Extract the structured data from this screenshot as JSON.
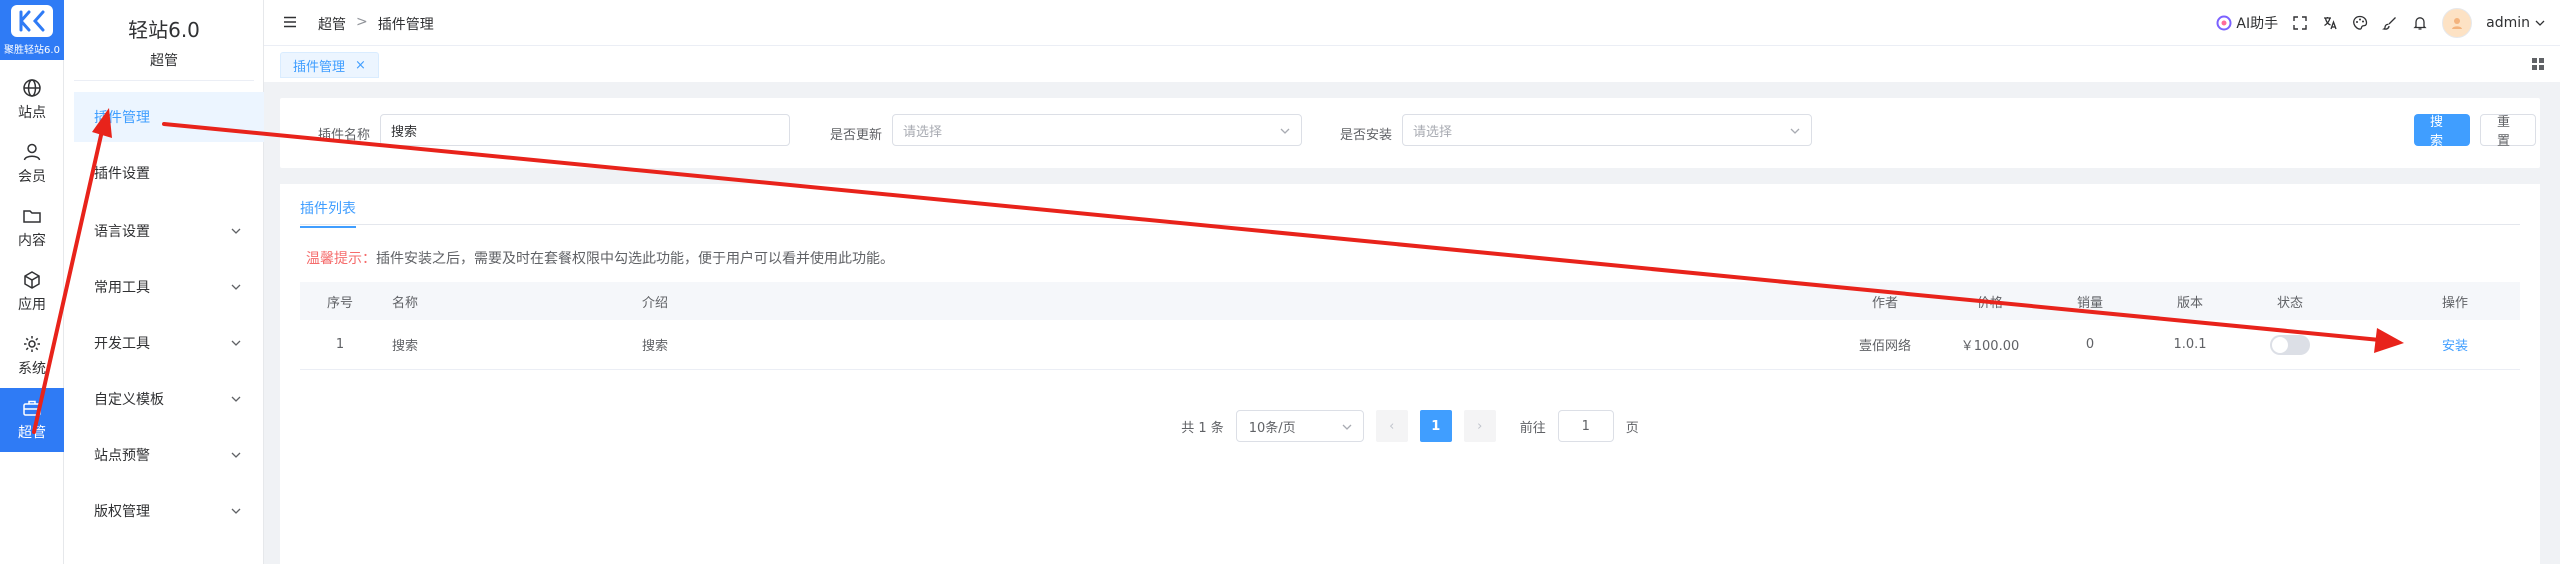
{
  "colors": {
    "brand": "#2f7bf5",
    "primary": "#409eff",
    "warn": "#f56c6c",
    "arrow": "#e8231b"
  },
  "logo": {
    "brand_text": "聚胜轻站6.0",
    "icon": "logo-icon"
  },
  "rail": [
    {
      "label": "站点",
      "icon": "globe-icon"
    },
    {
      "label": "会员",
      "icon": "user-icon"
    },
    {
      "label": "内容",
      "icon": "folder-icon"
    },
    {
      "label": "应用",
      "icon": "cube-icon"
    },
    {
      "label": "系统",
      "icon": "gear-icon"
    },
    {
      "label": "超管",
      "icon": "briefcase-icon"
    }
  ],
  "subside": {
    "title": "轻站6.0",
    "subtitle": "超管",
    "items": [
      {
        "label": "插件管理"
      },
      {
        "label": "插件设置"
      },
      {
        "label": "语言设置"
      },
      {
        "label": "常用工具"
      },
      {
        "label": "开发工具"
      },
      {
        "label": "自定义模板"
      },
      {
        "label": "站点预警"
      },
      {
        "label": "版权管理"
      }
    ]
  },
  "header": {
    "breadcrumb": [
      "超管",
      "插件管理"
    ],
    "breadcrumb_sep": ">",
    "ai_label": "AI助手",
    "username": "admin"
  },
  "tabs": [
    {
      "label": "插件管理",
      "close": "×"
    }
  ],
  "filter": {
    "name_label": "插件名称",
    "name_value": "搜索",
    "update_label": "是否更新",
    "update_placeholder": "请选择",
    "install_label": "是否安装",
    "install_placeholder": "请选择",
    "search_btn": "搜索",
    "reset_btn": "重置"
  },
  "list": {
    "tab_label": "插件列表",
    "tip_prefix": "温馨提示：",
    "tip_text": "插件安装之后，需要及时在套餐权限中勾选此功能，便于用户可以看并使用此功能。",
    "columns": [
      "序号",
      "名称",
      "介绍",
      "作者",
      "价格",
      "销量",
      "版本",
      "状态",
      "操作"
    ],
    "rows": [
      {
        "index": "1",
        "name": "搜索",
        "intro": "搜索",
        "author": "壹佰网络",
        "price": "￥100.00",
        "sales": "0",
        "version": "1.0.1",
        "status": false,
        "action": "安装"
      }
    ]
  },
  "pager": {
    "total": "共 1 条",
    "page_size": "10条/页",
    "prev": "‹",
    "current": "1",
    "next": "›",
    "goto_label": "前往",
    "goto_value": "1",
    "goto_suffix": "页"
  }
}
